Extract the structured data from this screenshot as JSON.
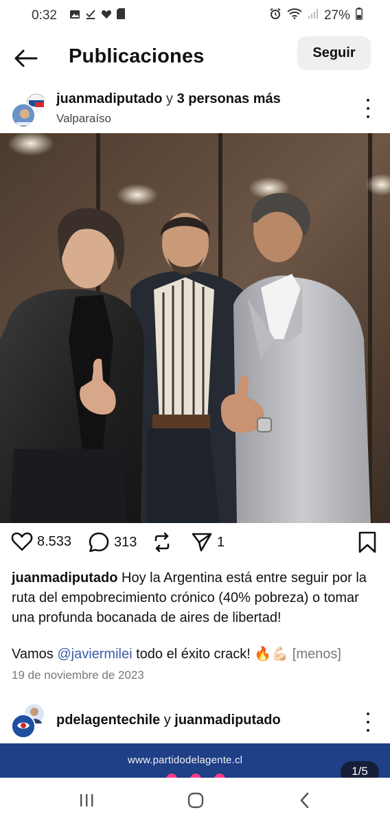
{
  "status_bar": {
    "time": "0:32",
    "notification_icons": [
      "image-icon",
      "check-download-icon",
      "heart-icon",
      "sd-card-icon"
    ],
    "system_icons": [
      "alarm-icon",
      "wifi-icon",
      "signal-icon"
    ],
    "battery": "27%"
  },
  "header": {
    "title": "Publicaciones",
    "follow_label": "Seguir"
  },
  "post": {
    "author": "juanmadiputado",
    "connector": "y",
    "others": "3 personas más",
    "location": "Valparaíso",
    "likes": "8.533",
    "comments": "313",
    "shares": "1",
    "caption_author": "juanmadiputado",
    "caption_text": "Hoy la Argentina está entre seguir por la ruta del empobrecimiento crónico (40% pobreza) o tomar una profunda bocanada de aires de libertad!",
    "caption_vamos": "Vamos",
    "caption_mention": "@javiermilei",
    "caption_end": "todo el éxito crack! 🔥💪🏻",
    "less_label": "[menos]",
    "date": "19 de noviembre de 2023"
  },
  "next_post": {
    "author": "pdelagentechile",
    "connector": "y",
    "coauthor": "juanmadiputado",
    "image_url_text": "www.partidodelagente.cl",
    "image_counter": "1/5"
  },
  "colors": {
    "mention": "#3b5da8",
    "follow_bg": "#eeeff1",
    "next_image_bg": "#1f3f86"
  }
}
